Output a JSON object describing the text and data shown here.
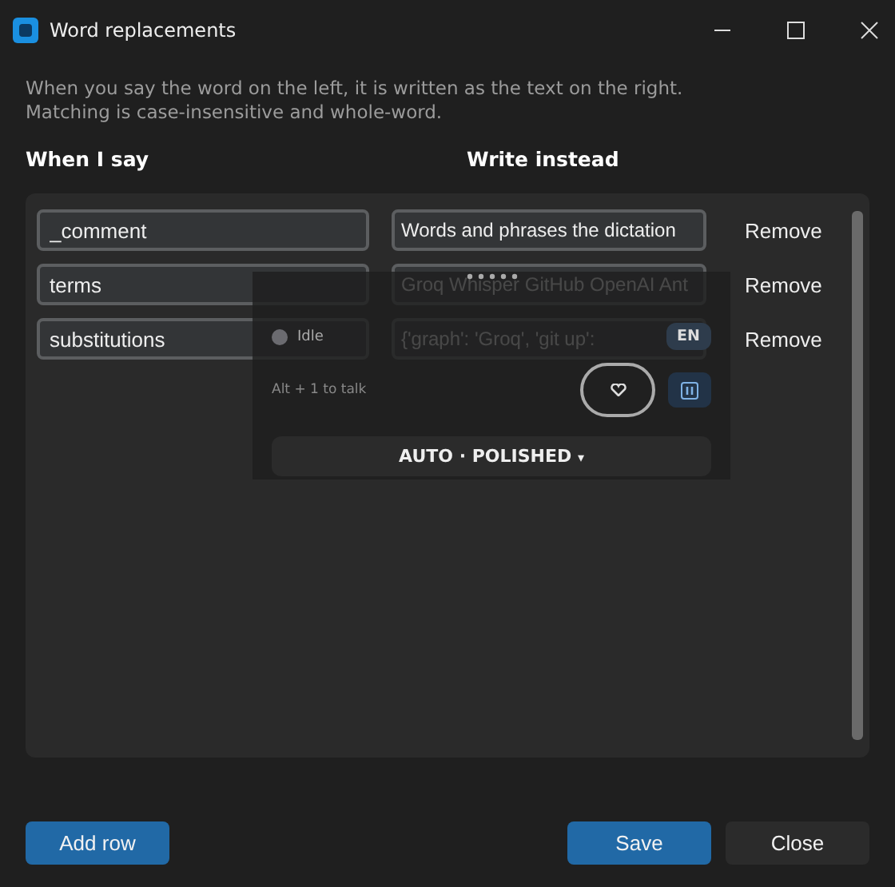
{
  "window": {
    "title": "Word replacements"
  },
  "description": [
    "When you say the word on the left, it is written as the text on the right.",
    "Matching is case-insensitive and whole-word."
  ],
  "columns": [
    "When I say",
    "Write instead"
  ],
  "rows": [
    {
      "say": "_comment",
      "write": "Words and phrases the dictation",
      "action": "Remove"
    },
    {
      "say": "terms",
      "write": "Groq Whisper GitHub OpenAI Ant",
      "action": "Remove"
    },
    {
      "say": "substitutions",
      "write": "{'graph': 'Groq', 'git up':",
      "action": "Remove"
    }
  ],
  "buttons": {
    "add": "Add row",
    "save": "Save",
    "close": "Close"
  },
  "overlay": {
    "status": "Idle",
    "language": "EN",
    "hint": "Alt + 1 to talk",
    "mode": "AUTO · POLISHED",
    "mode_caret": "▾"
  }
}
